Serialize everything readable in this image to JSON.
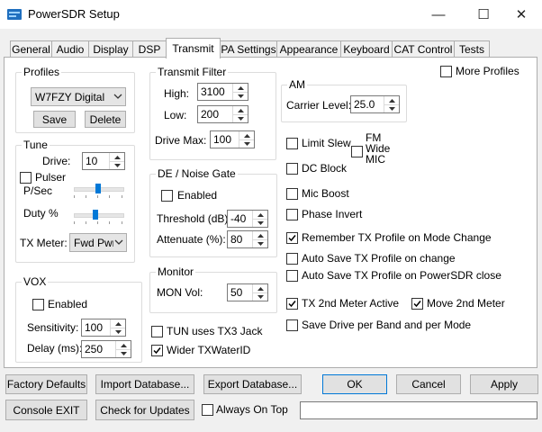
{
  "window": {
    "title": "PowerSDR Setup",
    "minimize_glyph": "—",
    "maximize_glyph": "☐",
    "close_glyph": "✕",
    "icon": "app-icon",
    "accent_color": "#0078d7"
  },
  "tabs": [
    {
      "label": "General"
    },
    {
      "label": "Audio"
    },
    {
      "label": "Display"
    },
    {
      "label": "DSP"
    },
    {
      "label": "Transmit",
      "active": true
    },
    {
      "label": "PA Settings"
    },
    {
      "label": "Appearance"
    },
    {
      "label": "Keyboard"
    },
    {
      "label": "CAT Control"
    },
    {
      "label": "Tests"
    }
  ],
  "profiles": {
    "title": "Profiles",
    "selected": "W7FZY Digital",
    "save": "Save",
    "delete": "Delete"
  },
  "tune": {
    "title": "Tune",
    "drive_label": "Drive:",
    "drive_value": "10",
    "pulser_label": "Pulser",
    "psec_label": "P/Sec",
    "duty_label": "Duty %",
    "psec_level": 0.5,
    "duty_level": 0.45,
    "txmeter_label": "TX Meter:",
    "txmeter_value": "Fwd Pwr"
  },
  "vox": {
    "title": "VOX",
    "enabled_label": "Enabled",
    "sensitivity_label": "Sensitivity:",
    "sensitivity_value": "100",
    "delay_label": "Delay (ms):",
    "delay_value": "250"
  },
  "transmit_filter": {
    "title": "Transmit Filter",
    "high_label": "High:",
    "high_value": "3100",
    "low_label": "Low:",
    "low_value": "200",
    "drivemax_label": "Drive Max:",
    "drivemax_value": "100"
  },
  "de_noise_gate": {
    "title": "DE / Noise Gate",
    "enabled_label": "Enabled",
    "threshold_label": "Threshold (dB):",
    "threshold_value": "-40",
    "attenuate_label": "Attenuate (%):",
    "attenuate_value": "80"
  },
  "monitor": {
    "title": "Monitor",
    "monvol_label": "MON Vol:",
    "monvol_value": "50"
  },
  "tun_tx3": {
    "label": "TUN uses TX3 Jack",
    "checked": false
  },
  "wider_txwaterid": {
    "label": "Wider TXWaterID",
    "checked": true
  },
  "am": {
    "title": "AM",
    "carrier_label": "Carrier Level:",
    "carrier_value": "25.0"
  },
  "more_profiles": {
    "label": "More Profiles",
    "checked": false
  },
  "options": {
    "limit_slew": {
      "label": "Limit Slew",
      "checked": false
    },
    "fm_wide_mic_line1": "FM",
    "fm_wide_mic_line2": "Wide",
    "fm_wide_mic_line3": "MIC",
    "dc_block": {
      "label": "DC Block",
      "checked": false
    },
    "mic_boost": {
      "label": "Mic Boost",
      "checked": false
    },
    "phase_invert": {
      "label": "Phase Invert",
      "checked": false
    },
    "remember_tx": {
      "label": "Remember TX Profile on Mode Change",
      "checked": true
    },
    "auto_save_change": {
      "label": "Auto Save TX Profile on change",
      "checked": false
    },
    "auto_save_close": {
      "label": "Auto Save TX Profile on PowerSDR close",
      "checked": false
    },
    "tx_2nd_meter": {
      "label": "TX 2nd Meter Active",
      "checked": true
    },
    "move_2nd_meter": {
      "label": "Move 2nd Meter",
      "checked": true
    },
    "save_drive": {
      "label": "Save Drive per Band and per Mode",
      "checked": false
    }
  },
  "bottom": {
    "factory_defaults": "Factory Defaults",
    "import_db": "Import Database...",
    "export_db": "Export Database...",
    "ok": "OK",
    "cancel": "Cancel",
    "apply": "Apply",
    "console_exit": "Console EXIT",
    "check_updates": "Check for Updates",
    "always_on_top": "Always On Top",
    "status_text": ""
  }
}
